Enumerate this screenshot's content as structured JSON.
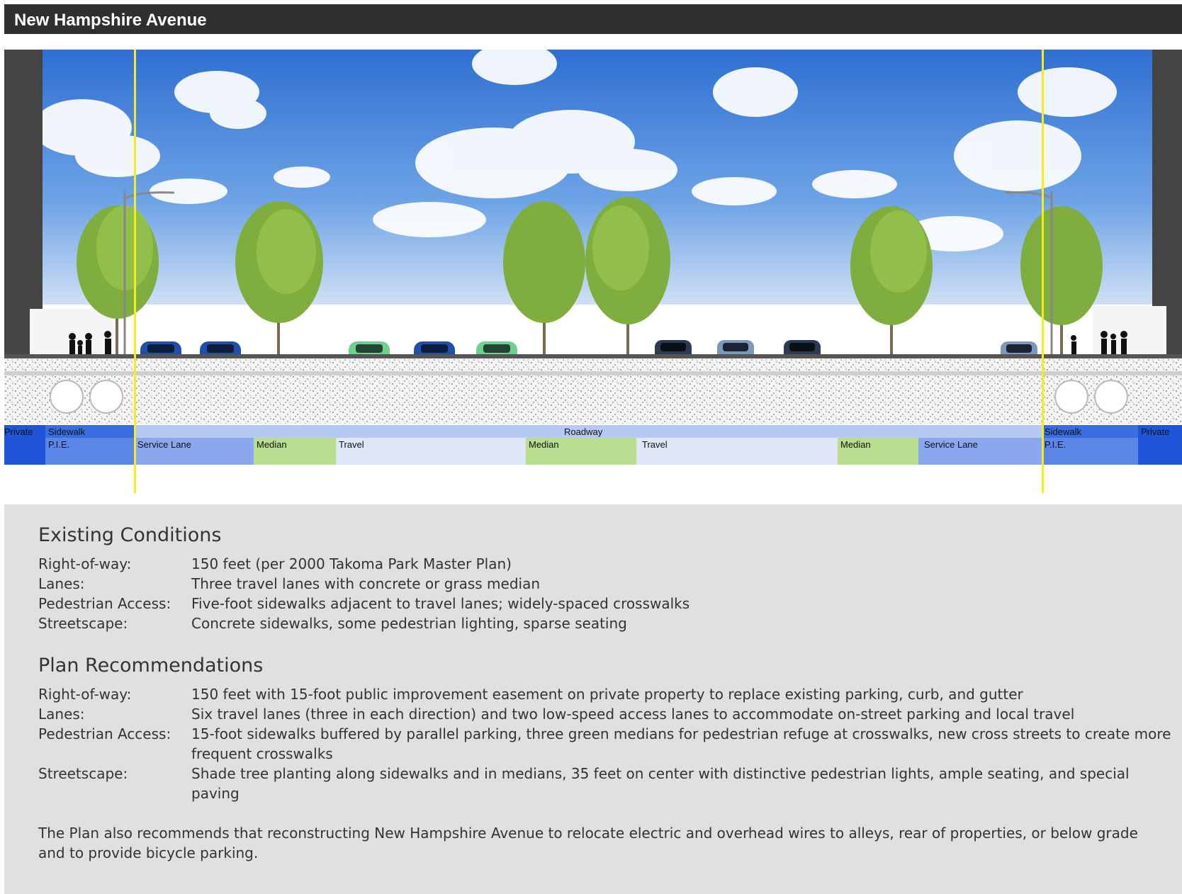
{
  "title": "New Hampshire Avenue",
  "section_labels": {
    "private_left": "Private",
    "sidewalk_left": "Sidewalk",
    "pie_left": "P.I.E.",
    "roadway": "Roadway",
    "service_lane_left": "Service Lane",
    "median_left": "Median",
    "travel_left": "Travel",
    "median_center": "Median",
    "travel_right": "Travel",
    "median_right": "Median",
    "service_lane_right": "Service Lane",
    "sidewalk_right": "Sidewalk",
    "pie_right": "P.I.E.",
    "private_right": "Private"
  },
  "colors": {
    "private": "#1f55d6",
    "sidewalk_bar": "#3a6ee0",
    "pie": "#5b86e8",
    "service_lane": "#8aa8f0",
    "median": "#b9dd90",
    "travel": "#dfe6f5",
    "roadway_bar": "#b6c9f2",
    "marker_line": "#f5ec1c",
    "sky": "#3f7ed8",
    "panel": "#dfe0e2"
  },
  "existing": {
    "heading": "Existing Conditions",
    "rows": [
      {
        "label": "Right-of-way:",
        "value": "150 feet (per 2000 Takoma Park Master Plan)"
      },
      {
        "label": "Lanes:",
        "value": "Three travel lanes with concrete or grass median"
      },
      {
        "label": "Pedestrian Access:",
        "value": "Five-foot sidewalks adjacent to travel lanes; widely-spaced crosswalks"
      },
      {
        "label": "Streetscape:",
        "value": "Concrete sidewalks, some pedestrian lighting, sparse seating"
      }
    ]
  },
  "plan": {
    "heading": "Plan Recommendations",
    "rows": [
      {
        "label": "Right-of-way:",
        "value": "150 feet with 15-foot public improvement easement on private property to replace existing parking, curb, and gutter"
      },
      {
        "label": "Lanes:",
        "value": "Six travel lanes (three in each direction) and two low-speed access lanes to accommodate on-street parking and local travel"
      },
      {
        "label": "Pedestrian Access:",
        "value": "15-foot sidewalks buffered by parallel parking, three green medians for pedestrian refuge at crosswalks, new cross streets to create more frequent crosswalks"
      },
      {
        "label": "Streetscape:",
        "value": "Shade tree planting along sidewalks and in medians, 35 feet on center with distinctive pedestrian lights, ample seating, and special paving"
      }
    ]
  },
  "note": "The Plan also recommends that reconstructing New Hampshire Avenue to relocate electric and overhead wires to alleys, rear of properties, or below grade and to provide bicycle parking."
}
